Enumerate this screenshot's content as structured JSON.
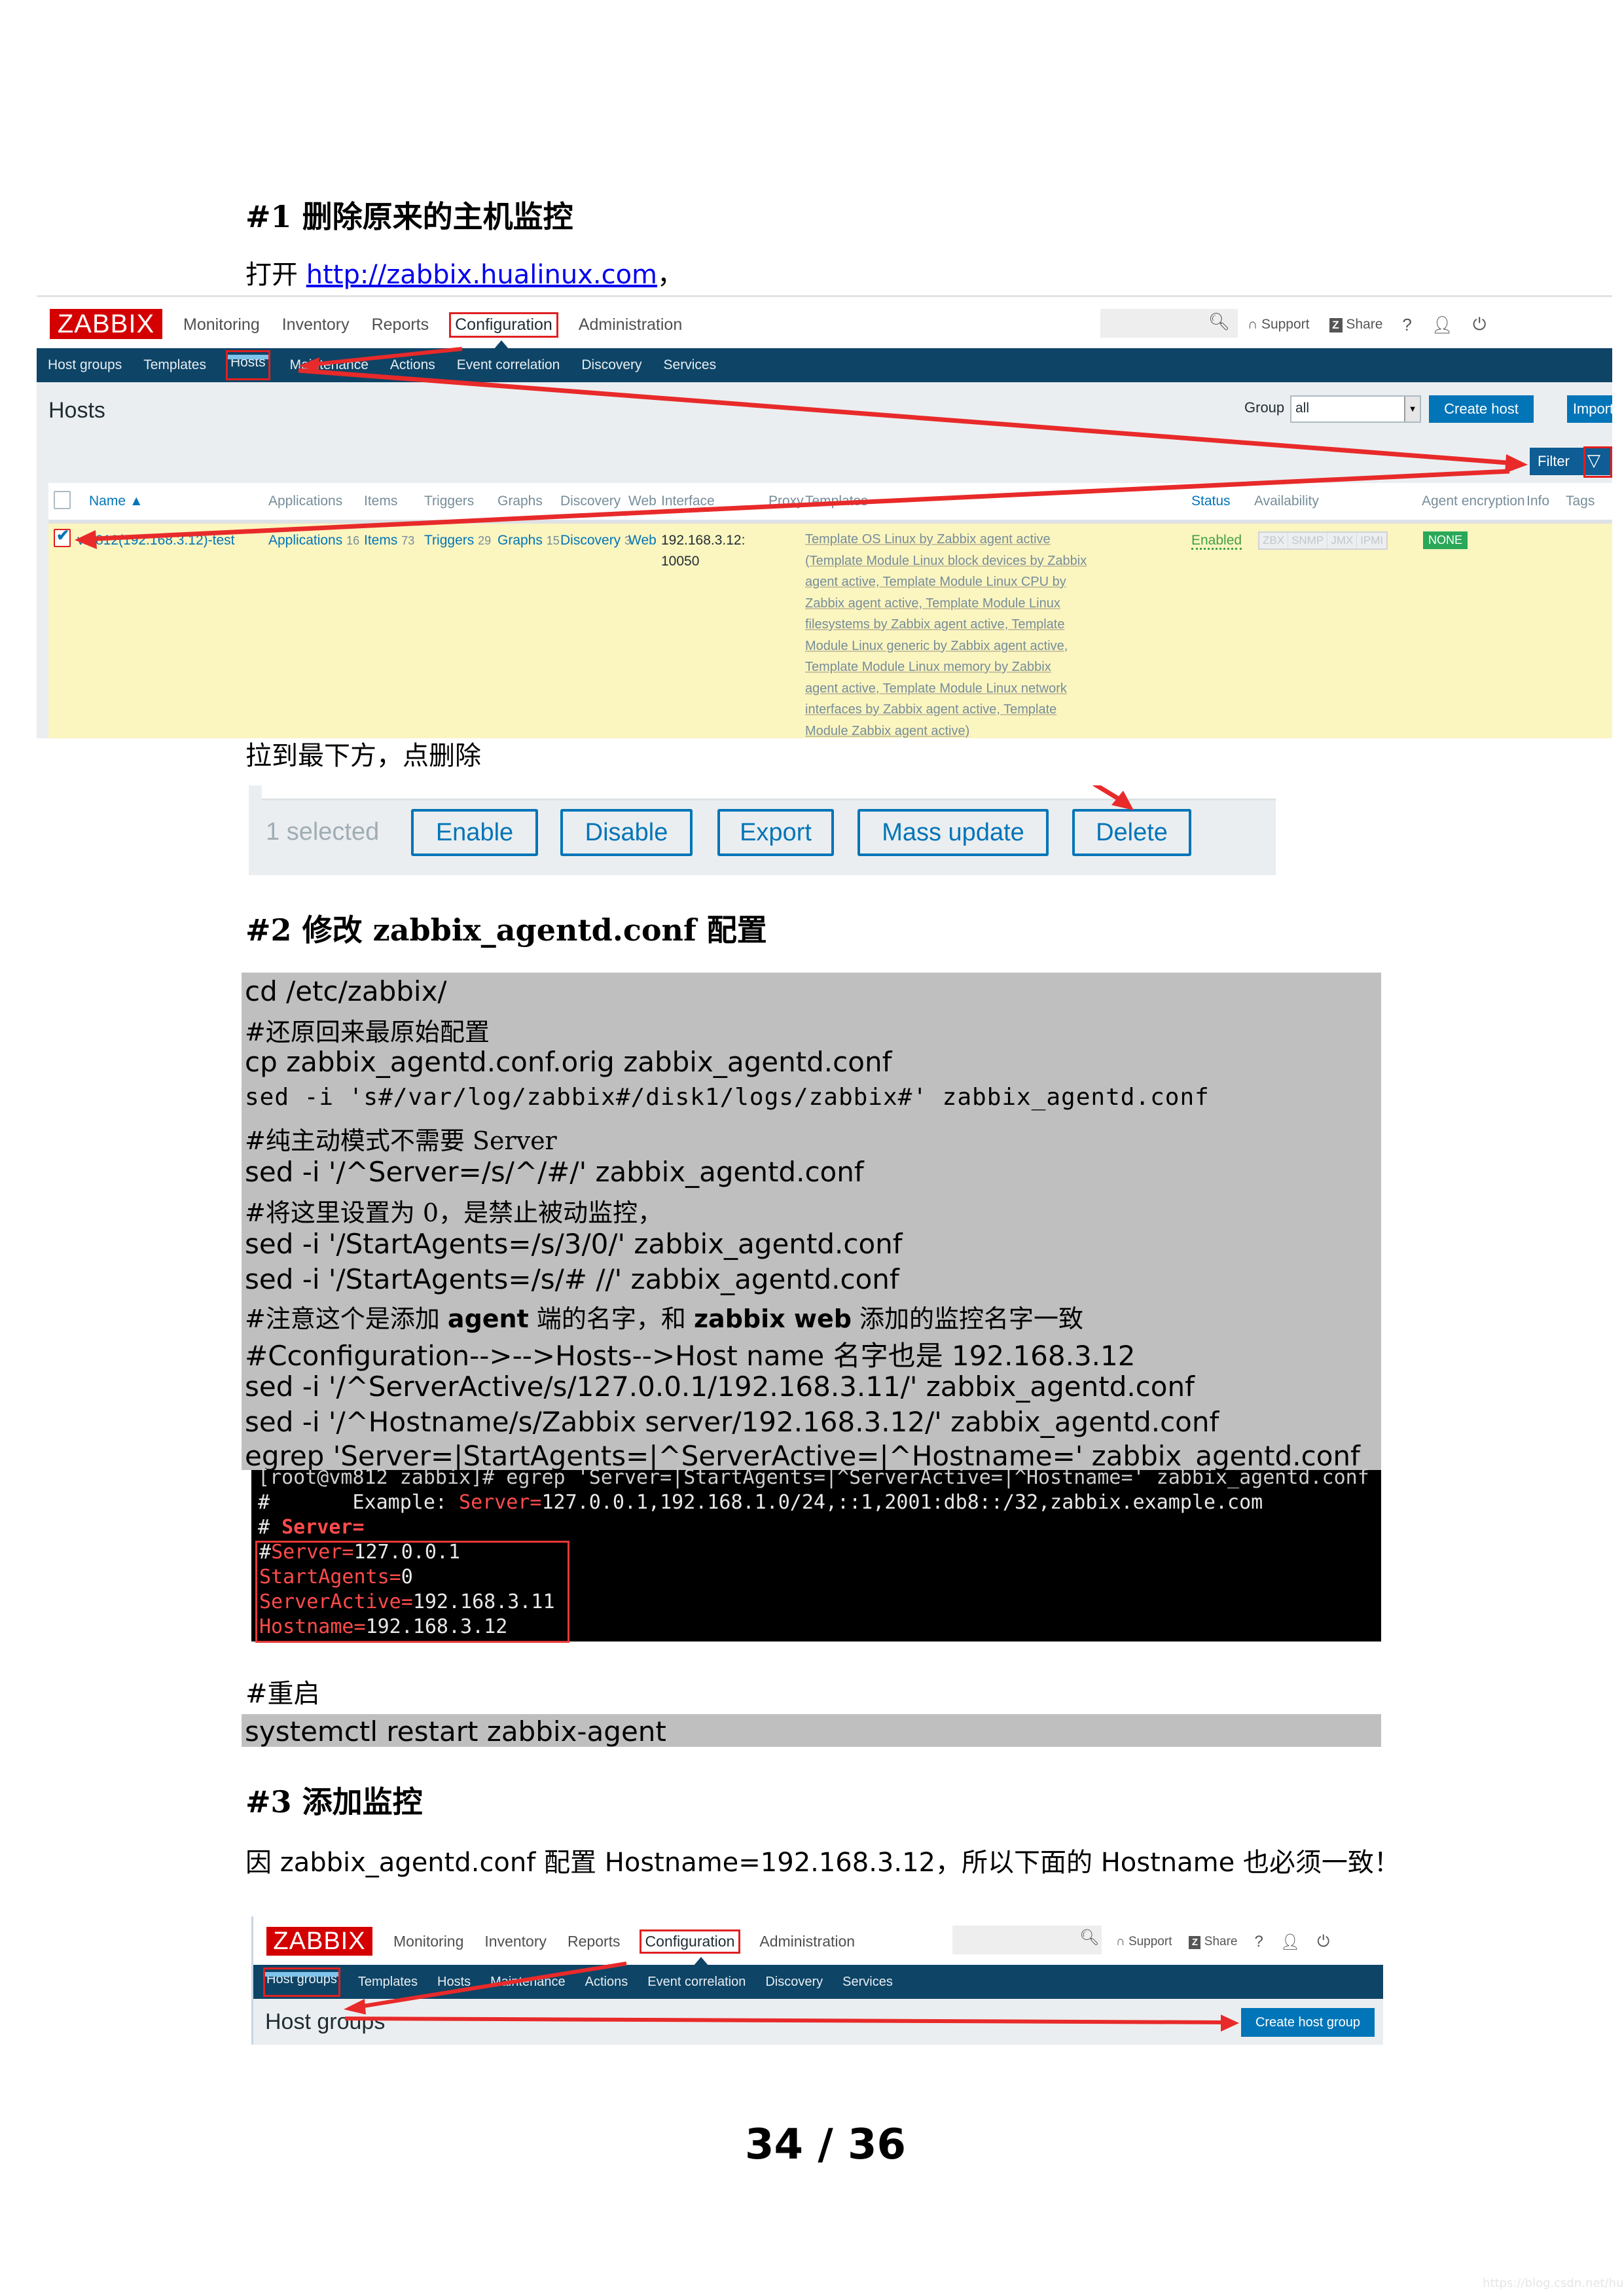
{
  "section1": {
    "heading": "#1 删除原来的主机监控",
    "open_prefix": "打开 ",
    "url": "http://zabbix.hualinux.com",
    "open_suffix": "，",
    "after_screenshot": "拉到最下方，点删除"
  },
  "zabbix_hosts": {
    "logo": "ZABBIX",
    "main_menu": [
      "Monitoring",
      "Inventory",
      "Reports",
      "Configuration",
      "Administration"
    ],
    "main_menu_active": "Configuration",
    "sub_menu": [
      "Host groups",
      "Templates",
      "Hosts",
      "Maintenance",
      "Actions",
      "Event correlation",
      "Discovery",
      "Services"
    ],
    "sub_menu_active": "Hosts",
    "search_placeholder": "",
    "tools": {
      "support": "Support",
      "share": "Share",
      "share_badge": "Z",
      "help": "?"
    },
    "page_title": "Hosts",
    "group_label": "Group",
    "group_value": "all",
    "create_button": "Create host",
    "import_button": "Import",
    "filter_label": "Filter",
    "columns": [
      "Name ▲",
      "Applications",
      "Items",
      "Triggers",
      "Graphs",
      "Discovery",
      "Web",
      "Interface",
      "Proxy",
      "Templates",
      "Status",
      "Availability",
      "Agent encryption",
      "Info",
      "Tags"
    ],
    "row": {
      "checked": true,
      "name": "vm812(192.168.3.12)-test",
      "applications": {
        "label": "Applications",
        "count": "16"
      },
      "items": {
        "label": "Items",
        "count": "73"
      },
      "triggers": {
        "label": "Triggers",
        "count": "29"
      },
      "graphs": {
        "label": "Graphs",
        "count": "15"
      },
      "discovery": {
        "label": "Discovery",
        "count": "3"
      },
      "web": "Web",
      "interface_line1": "192.168.3.12:",
      "interface_line2": "10050",
      "templates_lines": [
        "Template OS Linux by Zabbix agent active",
        "(Template Module Linux block devices by Zabbix",
        "agent active, Template Module Linux CPU by",
        "Zabbix agent active, Template Module Linux",
        "filesystems by Zabbix agent active, Template",
        "Module Linux generic by Zabbix agent active,",
        "Template Module Linux memory by Zabbix",
        "agent active, Template Module Linux network",
        "interfaces by Zabbix agent active, Template",
        "Module Zabbix agent active)"
      ],
      "status": "Enabled",
      "availability": [
        "ZBX",
        "SNMP",
        "JMX",
        "IPMI"
      ],
      "encryption": "NONE"
    }
  },
  "bulk_actions": {
    "selected": "1 selected",
    "buttons": [
      "Enable",
      "Disable",
      "Export",
      "Mass update",
      "Delete"
    ]
  },
  "section2": {
    "heading": "#2 修改 zabbix_agentd.conf 配置",
    "code_lines": [
      "cd /etc/zabbix/",
      "#还原回来最原始配置",
      "cp zabbix_agentd.conf.orig  zabbix_agentd.conf",
      "sed -i 's#/var/log/zabbix#/disk1/logs/zabbix#' zabbix_agentd.conf",
      "#纯主动模式不需要 Server",
      "sed -i '/^Server=/s/^/#/' zabbix_agentd.conf",
      "#将这里设置为 0，是禁止被动监控，",
      "sed -i '/StartAgents=/s/3/0/' zabbix_agentd.conf",
      "sed -i '/StartAgents=/s/# //' zabbix_agentd.conf",
      "#Cconfiguration-->-->Hosts-->Host name 名字也是 192.168.3.12",
      "sed -i '/^ServerActive/s/127.0.0.1/192.168.3.11/' zabbix_agentd.conf",
      "sed -i  '/^Hostname/s/Zabbix server/192.168.3.12/' zabbix_agentd.conf",
      "egrep 'Server=|StartAgents=|^ServerActive=|^Hostname=' zabbix_agentd.conf"
    ],
    "note_line": {
      "p1": "#注意这个是添加 ",
      "b1": "agent",
      "p2": " 端的名字，和 ",
      "b2": "zabbix web",
      "p3": " 添加的监控名字一致"
    },
    "terminal": {
      "prompt_line": "[root@vm812 zabbix]# egrep 'Server=|StartAgents=|^ServerActive=|^Hostname=' zabbix_agentd.conf",
      "example_prefix": "#       Example: ",
      "example_key": "Server=",
      "example_value": "127.0.0.1,192.168.1.0/24,::1,2001:db8::/32,zabbix.example.com",
      "commented_prefix": "# ",
      "commented_key": "Server=",
      "boxed": [
        {
          "prefix": "#",
          "key": "Server=",
          "value": "127.0.0.1"
        },
        {
          "prefix": "",
          "key": "StartAgents=",
          "value": "0"
        },
        {
          "prefix": "",
          "key": "ServerActive=",
          "value": "192.168.3.11"
        },
        {
          "prefix": "",
          "key": "Hostname=",
          "value": "192.168.3.12"
        }
      ]
    },
    "restart_comment": "#重启",
    "restart_cmd": "systemctl restart zabbix-agent"
  },
  "section3": {
    "heading": "#3 添加监控",
    "para": "因 zabbix_agentd.conf 配置 Hostname=192.168.3.12，所以下面的 Hostname 也必须一致！"
  },
  "zabbix_hostgroups": {
    "logo": "ZABBIX",
    "main_menu": [
      "Monitoring",
      "Inventory",
      "Reports",
      "Configuration",
      "Administration"
    ],
    "main_menu_active": "Configuration",
    "sub_menu": [
      "Host groups",
      "Templates",
      "Hosts",
      "Maintenance",
      "Actions",
      "Event correlation",
      "Discovery",
      "Services"
    ],
    "sub_menu_active": "Host groups",
    "tools": {
      "support": "Support",
      "share": "Share",
      "share_badge": "Z",
      "help": "?"
    },
    "page_title": "Host groups",
    "create_button": "Create host group"
  },
  "footer": {
    "page_number": "34 / 36",
    "watermark": "https://blog.csdn.net/hualinux"
  },
  "colors": {
    "zabbix_red": "#d40000",
    "zabbix_navy": "#0e4466",
    "zabbix_blue": "#0275b8",
    "annotation_red": "#e02020",
    "row_highlight": "#fbf5c0",
    "code_bg": "#bfbfbf"
  }
}
